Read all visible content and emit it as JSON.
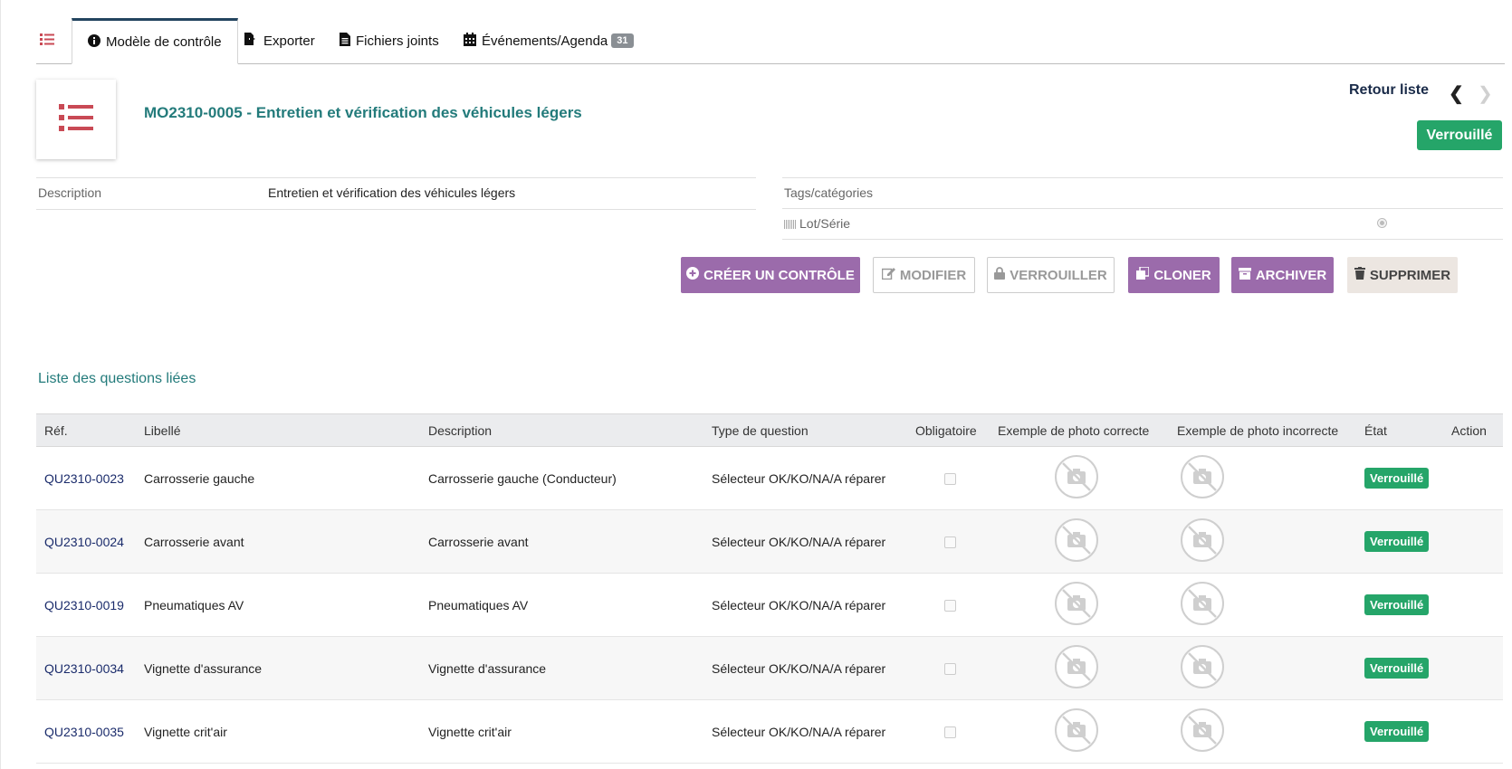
{
  "colors": {
    "accent": "#237b7b",
    "success": "#25a569",
    "purple": "#9b6bab",
    "navy": "#23445f"
  },
  "tabs": {
    "list_icon": "list-icon",
    "items": [
      {
        "label": "Modèle de contrôle",
        "icon": "info-circle-icon"
      },
      {
        "label": "Exporter",
        "icon": "export-icon"
      },
      {
        "label": "Fichiers joints",
        "icon": "file-icon"
      },
      {
        "label": "Événements/Agenda",
        "icon": "calendar-icon",
        "badge": "31"
      }
    ]
  },
  "header": {
    "title": "MO2310-0005 - Entretien et vérification des véhicules légers",
    "back_label": "Retour liste",
    "status": "Verrouillé"
  },
  "info": {
    "description_label": "Description",
    "description_value": "Entretien et vérification des véhicules légers",
    "tags_label": "Tags/catégories",
    "lot_label": "Lot/Série"
  },
  "actions": {
    "create": "CRÉER UN CONTRÔLE",
    "modify": "MODIFIER",
    "lock": "VERROUILLER",
    "clone": "CLONER",
    "archive": "ARCHIVER",
    "delete": "SUPPRIMER"
  },
  "questions": {
    "title": "Liste des questions liées",
    "columns": [
      "Réf.",
      "Libellé",
      "Description",
      "Type de question",
      "Obligatoire",
      "Exemple de photo correcte",
      "Exemple de photo incorrecte",
      "État",
      "Action"
    ],
    "rows": [
      {
        "ref": "QU2310-0023",
        "label": "Carrosserie gauche",
        "description": "Carrosserie gauche (Conducteur)",
        "type": "Sélecteur OK/KO/NA/A réparer",
        "state": "Verrouillé"
      },
      {
        "ref": "QU2310-0024",
        "label": "Carrosserie avant",
        "description": "Carrosserie avant",
        "type": "Sélecteur OK/KO/NA/A réparer",
        "state": "Verrouillé"
      },
      {
        "ref": "QU2310-0019",
        "label": "Pneumatiques AV",
        "description": "Pneumatiques AV",
        "type": "Sélecteur OK/KO/NA/A réparer",
        "state": "Verrouillé"
      },
      {
        "ref": "QU2310-0034",
        "label": "Vignette d'assurance",
        "description": "Vignette d'assurance",
        "type": "Sélecteur OK/KO/NA/A réparer",
        "state": "Verrouillé"
      },
      {
        "ref": "QU2310-0035",
        "label": "Vignette crit'air",
        "description": "Vignette crit'air",
        "type": "Sélecteur OK/KO/NA/A réparer",
        "state": "Verrouillé"
      }
    ]
  }
}
